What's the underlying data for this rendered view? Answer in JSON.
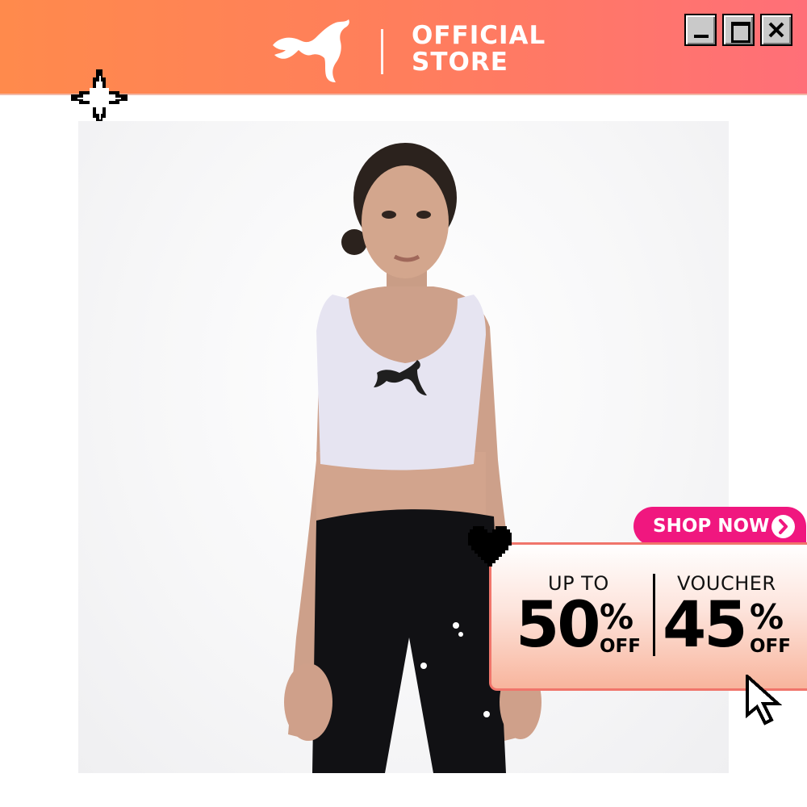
{
  "window": {
    "brand_name": "PUMA",
    "store_line1": "OFFICIAL",
    "store_line2": "STORE",
    "controls": [
      "minimize",
      "maximize",
      "close"
    ]
  },
  "product_photo": {
    "subject": "model wearing sports bra and leggings"
  },
  "promo": {
    "cta_label": "SHOP NOW",
    "left": {
      "label": "UP TO",
      "value": "50",
      "percent": "%",
      "suffix": "OFF"
    },
    "right": {
      "label": "VOUCHER",
      "value": "45",
      "percent": "%",
      "suffix": "OFF"
    }
  },
  "colors": {
    "titlebar_start": "#ff8a4c",
    "titlebar_end": "#ff6f78",
    "cta": "#f0177f",
    "promo_border": "#f0756b"
  },
  "icons": [
    "puma-cat-icon",
    "minimize-icon",
    "maximize-icon",
    "close-icon",
    "sparkle-icon",
    "heart-icon",
    "cursor-icon",
    "arrow-right-icon"
  ]
}
